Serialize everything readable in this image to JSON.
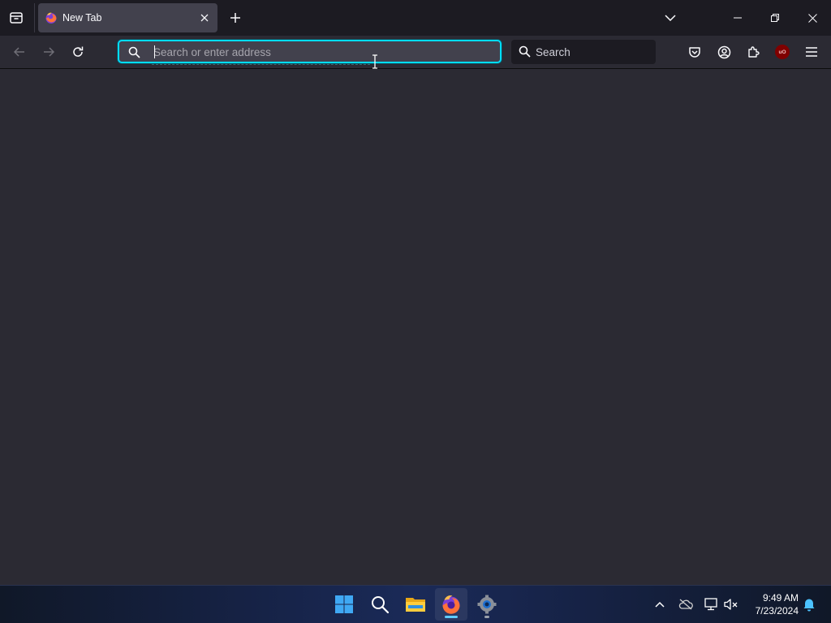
{
  "browser": {
    "tabs": [
      {
        "title": "New Tab",
        "active": true,
        "favicon": "firefox-icon"
      }
    ],
    "urlbar": {
      "placeholder": "Search or enter address",
      "value": ""
    },
    "searchbar": {
      "placeholder": "Search",
      "value": ""
    },
    "toolbar_icons": [
      "back-arrow-icon",
      "forward-arrow-icon",
      "reload-icon",
      "pocket-icon",
      "account-icon",
      "extensions-icon",
      "ublock-origin-icon",
      "hamburger-menu-icon"
    ],
    "ublock_badge": "uO",
    "colors": {
      "toolbar": "#2b2a33",
      "tabstrip": "#1c1b22",
      "active_tab": "#42414d",
      "focus_ring": "#00ddff",
      "content_bg": "#2b2a33"
    }
  },
  "taskbar": {
    "apps": [
      "windows-start-icon",
      "search-icon",
      "file-explorer-icon",
      "firefox-icon",
      "settings-gear-icon"
    ],
    "active_app": "firefox-icon",
    "tray_icons": [
      "chevron-up-icon",
      "onedrive-cloud-icon",
      "network-icon",
      "volume-muted-icon",
      "notification-bell-icon"
    ],
    "clock": {
      "time": "9:49 AM",
      "date": "7/23/2024"
    }
  }
}
